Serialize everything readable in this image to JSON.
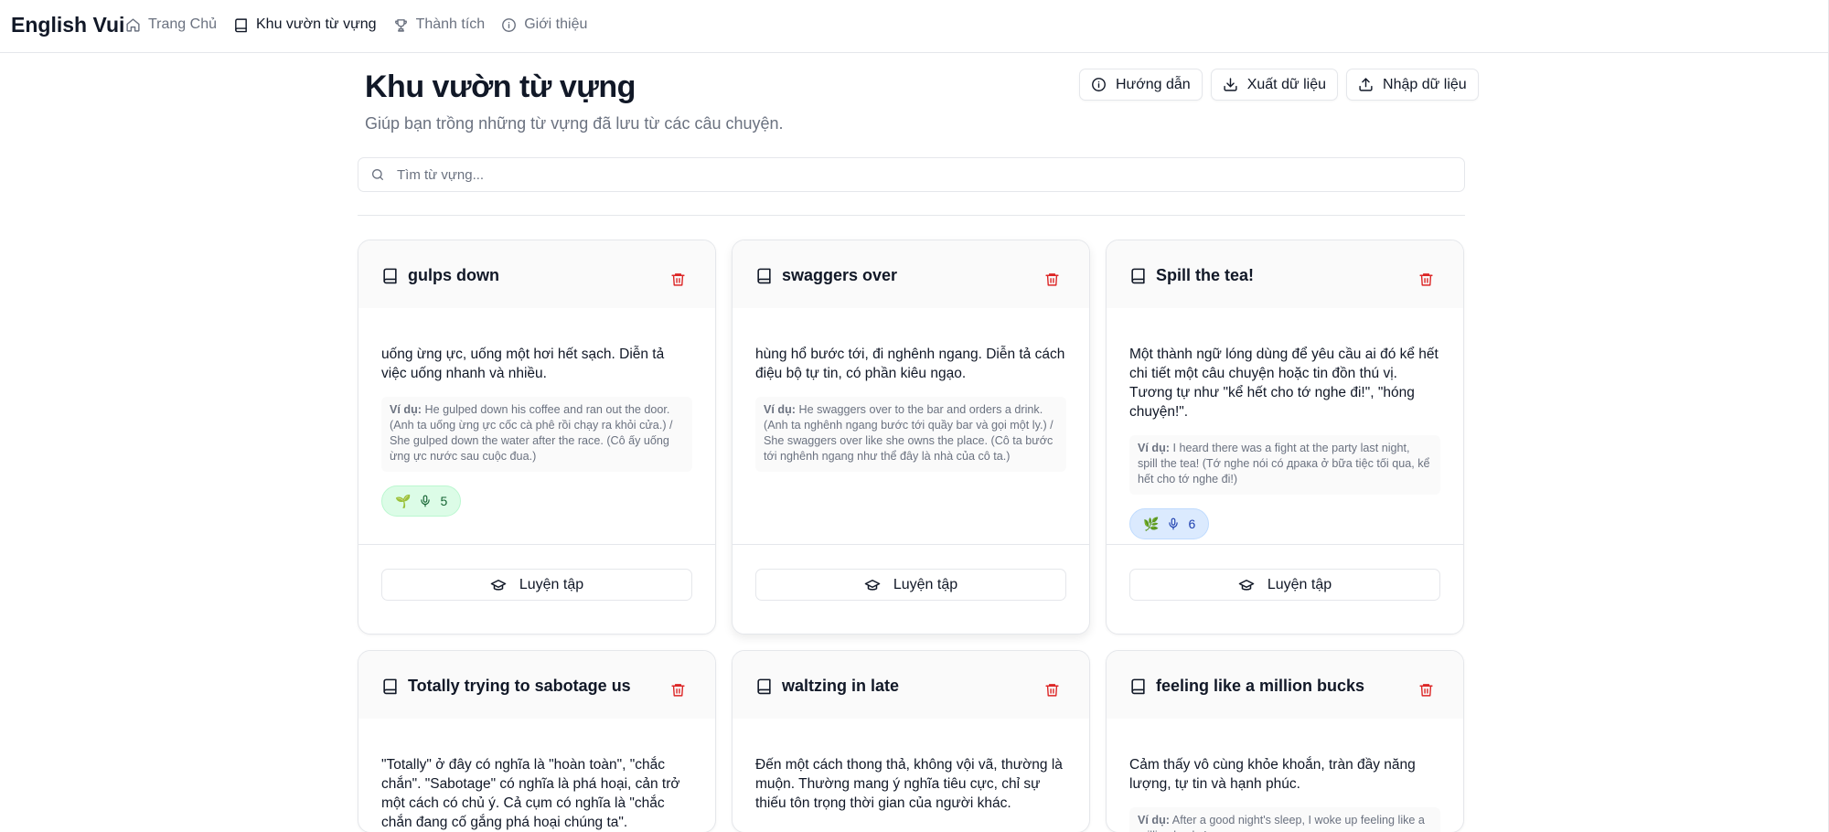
{
  "app": {
    "brand": "English Vui"
  },
  "nav": [
    {
      "label": "Trang Chủ",
      "icon": "home-icon",
      "active": false
    },
    {
      "label": "Khu vườn từ vựng",
      "icon": "book-icon",
      "active": true
    },
    {
      "label": "Thành tích",
      "icon": "trophy-icon",
      "active": false
    },
    {
      "label": "Giới thiệu",
      "icon": "info-icon",
      "active": false
    }
  ],
  "page": {
    "title": "Khu vườn từ vựng",
    "subtitle": "Giúp bạn trồng những từ vựng đã lưu từ các câu chuyện."
  },
  "actions": {
    "guide": "Hướng dẫn",
    "export": "Xuất dữ liệu",
    "import": "Nhập dữ liệu"
  },
  "search": {
    "placeholder": "Tìm từ vựng..."
  },
  "colors": {
    "danger": "#dc2626",
    "green_badge": "#dcfce7",
    "blue_badge": "#dbeafe"
  },
  "example_prefix": "Ví dụ:",
  "practice_label": "Luyện tập",
  "cards": [
    {
      "title": "gulps down",
      "meaning": "uống ừng ực, uống một hơi hết sạch. Diễn tả việc uống nhanh và nhiều.",
      "example": "He gulped down his coffee and ran out the door. (Anh ta uống ừng ực cốc cà phê rồi chạy ra khỏi cửa.) / She gulped down the water after the race. (Cô ấy uống ừng ực nước sau cuộc đua.)",
      "badge": {
        "emoji": "🌱",
        "count": "5",
        "color": "green"
      }
    },
    {
      "title": "swaggers over",
      "meaning": "hùng hổ bước tới, đi nghênh ngang. Diễn tả cách điệu bộ tự tin, có phần kiêu ngạo.",
      "example": "He swaggers over to the bar and orders a drink. (Anh ta nghênh ngang bước tới quầy bar và gọi một ly.) / She swaggers over like she owns the place. (Cô ta bước tới nghênh ngang như thể đây là nhà của cô ta.)",
      "badge": null
    },
    {
      "title": "Spill the tea!",
      "meaning": "Một thành ngữ lóng dùng để yêu cầu ai đó kể hết chi tiết một câu chuyện hoặc tin đồn thú vị. Tương tự như \"kể hết cho tớ nghe đi!\", \"hóng chuyện!\".",
      "example": "I heard there was a fight at the party last night, spill the tea! (Tớ nghe nói có драка ở bữa tiệc tối qua, kể hết cho tớ nghe đi!)",
      "badge": {
        "emoji": "🌿",
        "count": "6",
        "color": "blue"
      }
    },
    {
      "title": "Totally trying to sabotage us",
      "meaning": "\"Totally\" ở đây có nghĩa là \"hoàn toàn\", \"chắc chắn\". \"Sabotage\" có nghĩa là phá hoại, cản trở một cách có chủ ý. Cả cụm có nghĩa là \"chắc chắn đang cố gắng phá hoại chúng ta\".",
      "example": "",
      "badge": null
    },
    {
      "title": "waltzing in late",
      "meaning": "Đến một cách thong thả, không vội vã, thường là muộn. Thường mang ý nghĩa tiêu cực, chỉ sự thiếu tôn trọng thời gian của người khác.",
      "example": "",
      "badge": null
    },
    {
      "title": "feeling like a million bucks",
      "meaning": "Cảm thấy vô cùng khỏe khoắn, tràn đầy năng lượng, tự tin và hạnh phúc.",
      "example": "After a good night's sleep, I woke up feeling like a million bucks!",
      "badge": null
    }
  ]
}
